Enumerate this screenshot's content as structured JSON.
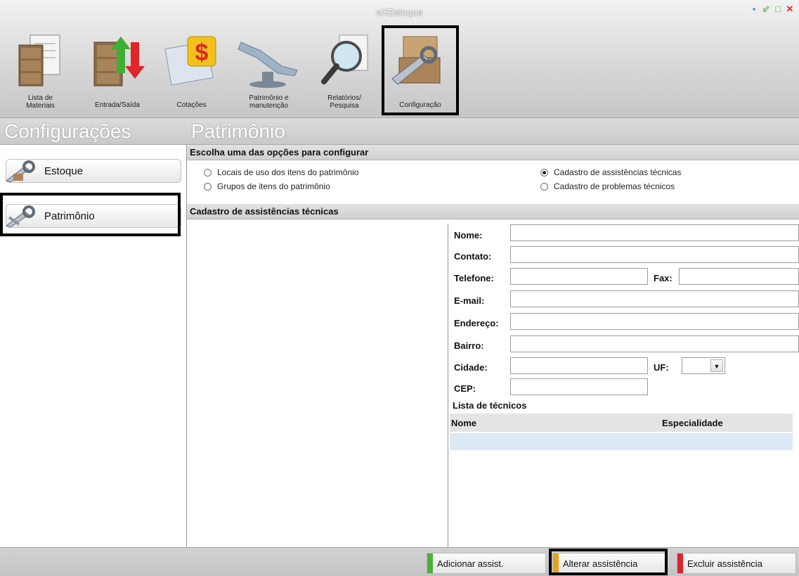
{
  "window": {
    "title": "eXEstoque"
  },
  "toolbar": {
    "tools": [
      {
        "label_line1": "Lista de",
        "label_line2": "Materiais",
        "icon": "cabinet-list-icon"
      },
      {
        "label_line1": "Entrada/Saída",
        "label_line2": "",
        "icon": "in-out-arrows-icon"
      },
      {
        "label_line1": "Cotações",
        "label_line2": "",
        "icon": "dollar-folder-icon"
      },
      {
        "label_line1": "Patrimônio e",
        "label_line2": "manutenção",
        "icon": "dental-chair-icon"
      },
      {
        "label_line1": "Relatórios/",
        "label_line2": "Pesquisa",
        "icon": "magnifier-icon"
      },
      {
        "label_line1": "Configuração",
        "label_line2": "",
        "icon": "wrench-box-icon"
      }
    ]
  },
  "sections": {
    "left_title": "Configurações",
    "right_title": "Patrimônio"
  },
  "sidebar": {
    "items": [
      {
        "label": "Estoque",
        "icon": "wrench-icon"
      },
      {
        "label": "Patrimônio",
        "icon": "wrench-icon"
      }
    ]
  },
  "options": {
    "header": "Escolha uma das opções para configurar",
    "radios": [
      {
        "label": "Locais de uso dos itens do patrimônio",
        "checked": false
      },
      {
        "label": "Grupos de itens do patrimônio",
        "checked": false
      },
      {
        "label": "Cadastro de assistências técnicas",
        "checked": true
      },
      {
        "label": "Cadastro de problemas técnicos",
        "checked": false
      }
    ]
  },
  "form": {
    "header": "Cadastro de assistências técnicas",
    "labels": {
      "nome": "Nome:",
      "contato": "Contato:",
      "telefone": "Telefone:",
      "fax": "Fax:",
      "email": "E-mail:",
      "endereco": "Endereço:",
      "bairro": "Bairro:",
      "cidade": "Cidade:",
      "uf": "UF:",
      "cep": "CEP:"
    },
    "values": {
      "nome": "",
      "contato": "",
      "telefone": "",
      "fax": "",
      "email": "",
      "endereco": "",
      "bairro": "",
      "cidade": "",
      "uf": "",
      "cep": ""
    }
  },
  "technicians": {
    "title": "Lista de técnicos",
    "columns": [
      "Nome",
      "Especialidade"
    ]
  },
  "actions": {
    "add": "Adicionar assist.",
    "edit": "Alterar assistência",
    "delete": "Excluir assistência"
  },
  "colors": {
    "add_stripe": "#4caf3a",
    "edit_stripe": "#e6a01c",
    "delete_stripe": "#d9262b"
  }
}
